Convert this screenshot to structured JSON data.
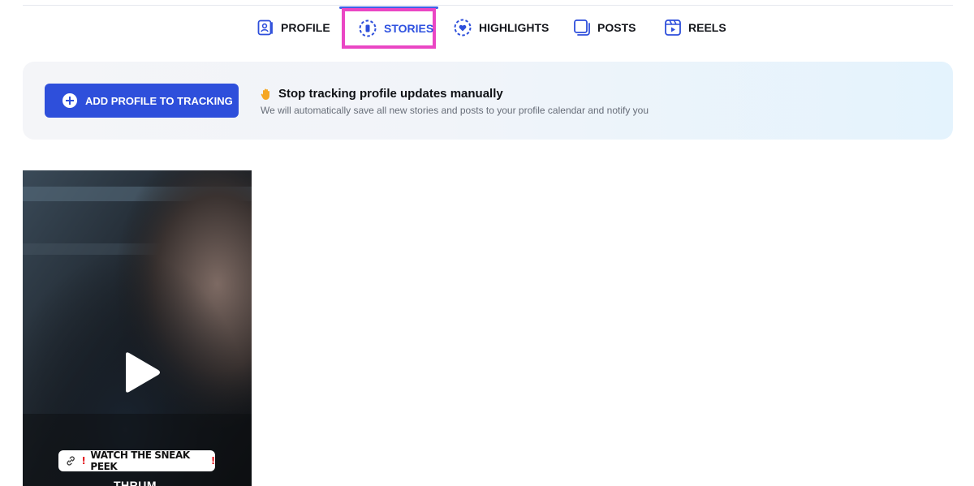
{
  "tabs": [
    {
      "label": "PROFILE",
      "icon": "profile-icon",
      "active": false
    },
    {
      "label": "STORIES",
      "icon": "stories-icon",
      "active": true
    },
    {
      "label": "HIGHLIGHTS",
      "icon": "highlights-icon",
      "active": false
    },
    {
      "label": "POSTS",
      "icon": "posts-icon",
      "active": false
    },
    {
      "label": "REELS",
      "icon": "reels-icon",
      "active": false
    }
  ],
  "banner": {
    "button_label": "ADD PROFILE TO TRACKING",
    "title": "Stop tracking profile updates manually",
    "title_icon": "raised-hand-icon",
    "description": "We will automatically save all new stories and posts to your profile calendar and notify you"
  },
  "stories": [
    {
      "type": "video",
      "sticker_text": "WATCH THE SNEAK PEEK",
      "caption": "THRUM"
    }
  ],
  "colors": {
    "accent": "#2e4fdb",
    "highlight_box": "#ea46c4",
    "text": "#15171c",
    "muted": "#676d78"
  }
}
